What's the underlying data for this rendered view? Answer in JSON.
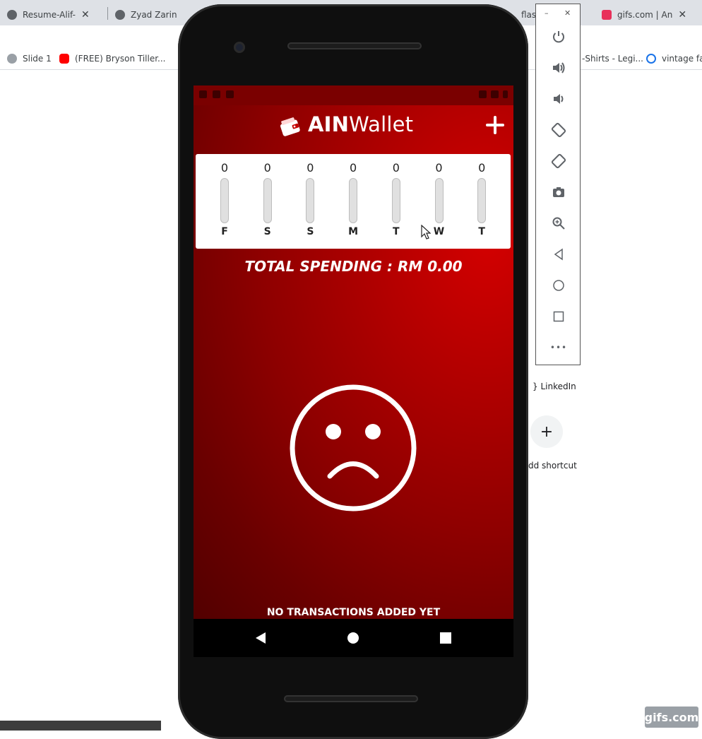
{
  "browser": {
    "tabs": [
      {
        "title": "Resume-Alif-",
        "close": "✕"
      },
      {
        "title": "Zyad Zarin Re",
        "close": ""
      },
      {
        "title": "flasl",
        "close": "✕"
      },
      {
        "title": "gifs.com | An",
        "close": "✕"
      }
    ],
    "bookmarks": [
      {
        "label": "Slide 1"
      },
      {
        "label": "(FREE) Bryson Tiller..."
      },
      {
        "label": "-Shirts - Legi..."
      },
      {
        "label": "vintage fak"
      }
    ],
    "shortcuts": {
      "linkedin_label": "} LinkedIn",
      "add_shortcut_label": "dd shortcut",
      "add_shortcut_symbol": "+"
    },
    "watermark": "gifs.com"
  },
  "emulator_toolbar": {
    "minimize": "–",
    "close": "✕",
    "buttons": [
      "power-icon",
      "volume-up-icon",
      "volume-down-icon",
      "rotate-left-icon",
      "rotate-right-icon",
      "camera-icon",
      "zoom-icon",
      "back-icon",
      "home-icon",
      "overview-icon",
      "more-icon"
    ],
    "more_label": "•••"
  },
  "app": {
    "title_bold": "AIN",
    "title_regular": "Wallet",
    "add_symbol": "+",
    "weekly_chart": [
      {
        "day": "F",
        "amount": "0",
        "fraction": 0
      },
      {
        "day": "S",
        "amount": "0",
        "fraction": 0
      },
      {
        "day": "S",
        "amount": "0",
        "fraction": 0
      },
      {
        "day": "M",
        "amount": "0",
        "fraction": 0
      },
      {
        "day": "T",
        "amount": "0",
        "fraction": 0
      },
      {
        "day": "W",
        "amount": "0",
        "fraction": 0
      },
      {
        "day": "T",
        "amount": "0",
        "fraction": 0
      }
    ],
    "total_spending": "TOTAL SPENDING : RM 0.00",
    "empty_message": "NO TRANSACTIONS ADDED YET",
    "colors": {
      "primary": "#c40000",
      "dark": "#520000",
      "card": "#ffffff"
    }
  }
}
